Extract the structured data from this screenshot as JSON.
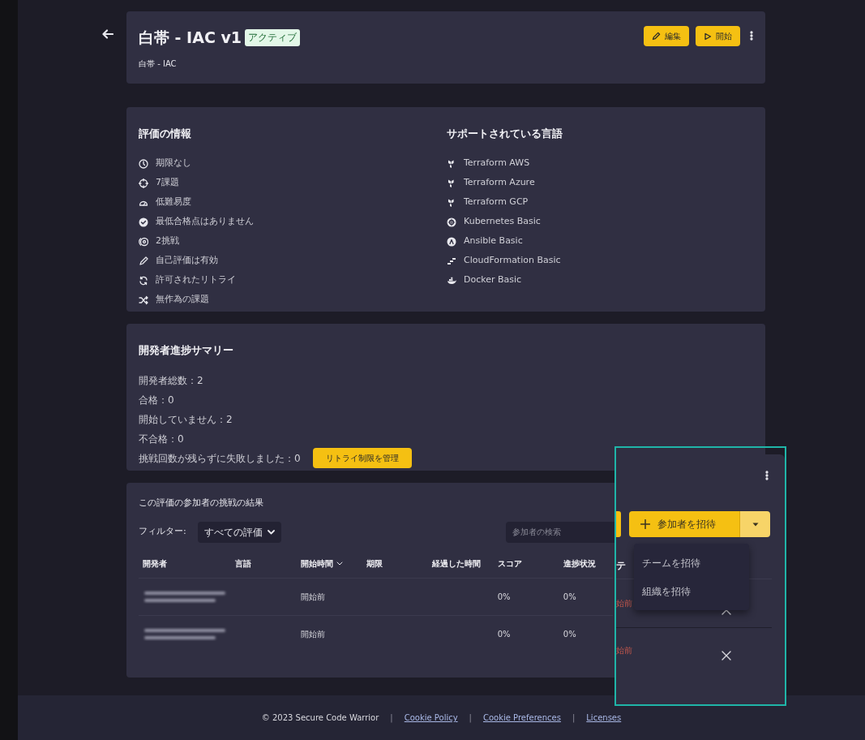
{
  "assessment": {
    "title": "白帯 - IAC v1",
    "status_badge": "アクティブ",
    "subtitle": "白帯 - IAC",
    "actions": [
      {
        "label": "編集",
        "kind": "edit"
      },
      {
        "label": "開始",
        "kind": "start"
      }
    ]
  },
  "info": {
    "title": "評価の情報",
    "items": [
      {
        "kind": "clock",
        "text": "期限なし"
      },
      {
        "kind": "target",
        "text": "7課題"
      },
      {
        "kind": "gauge",
        "text": "低難易度"
      },
      {
        "kind": "check",
        "text": "最低合格点はありません"
      },
      {
        "kind": "attempts",
        "text": "2挑戦"
      },
      {
        "kind": "pencil",
        "text": "自己評価は有効"
      },
      {
        "kind": "retry",
        "text": "許可されたリトライ"
      },
      {
        "kind": "shuffle",
        "text": "無作為の課題"
      }
    ]
  },
  "languages": {
    "title": "サポートされている言語",
    "items": [
      {
        "kind": "terraform",
        "text": "Terraform AWS"
      },
      {
        "kind": "terraform",
        "text": "Terraform Azure"
      },
      {
        "kind": "terraform",
        "text": "Terraform GCP"
      },
      {
        "kind": "kubernetes",
        "text": "Kubernetes Basic"
      },
      {
        "kind": "ansible",
        "text": "Ansible Basic"
      },
      {
        "kind": "cloudformation",
        "text": "CloudFormation Basic"
      },
      {
        "kind": "docker",
        "text": "Docker Basic"
      }
    ]
  },
  "summary": {
    "title": "開発者進捗サマリー",
    "stats": [
      "開発者総数：2",
      "合格：0",
      "開始していません：2",
      "不合格：0",
      "挑戦回数が残らずに失敗しました：0"
    ],
    "retry_button": "リトライ制限を管理"
  },
  "results": {
    "title": "この評価の参加者の挑戦の結果",
    "filter_label": "フィルター:",
    "filter_value": "すべての評価",
    "search": {
      "placeholder": "参加者の検索"
    },
    "columns": [
      {
        "label": "開発者",
        "sorted": false
      },
      {
        "label": "言語",
        "sorted": false
      },
      {
        "label": "開始時間",
        "sorted": true
      },
      {
        "label": "期限",
        "sorted": false
      },
      {
        "label": "経過した時間",
        "sorted": false
      },
      {
        "label": "スコア",
        "sorted": false
      },
      {
        "label": "進捗状況",
        "sorted": false
      }
    ],
    "rows": [
      {
        "start": "開始前",
        "score": "0%",
        "progress": "0%"
      },
      {
        "start": "開始前",
        "score": "0%",
        "progress": "0%"
      }
    ]
  },
  "overlay": {
    "invite_button": "参加者を招待",
    "menu": [
      "チームを招待",
      "組織を招待"
    ],
    "column_partial": "テ",
    "rows": [
      {
        "status": "始前"
      },
      {
        "status": "始前"
      }
    ]
  },
  "footer": {
    "copyright": "© 2023 Secure Code Warrior",
    "links": [
      {
        "separator": "|",
        "label": "Cookie Policy"
      },
      {
        "separator": "|",
        "label": "Cookie Preferences"
      },
      {
        "separator": "|",
        "label": "Licenses"
      }
    ]
  }
}
